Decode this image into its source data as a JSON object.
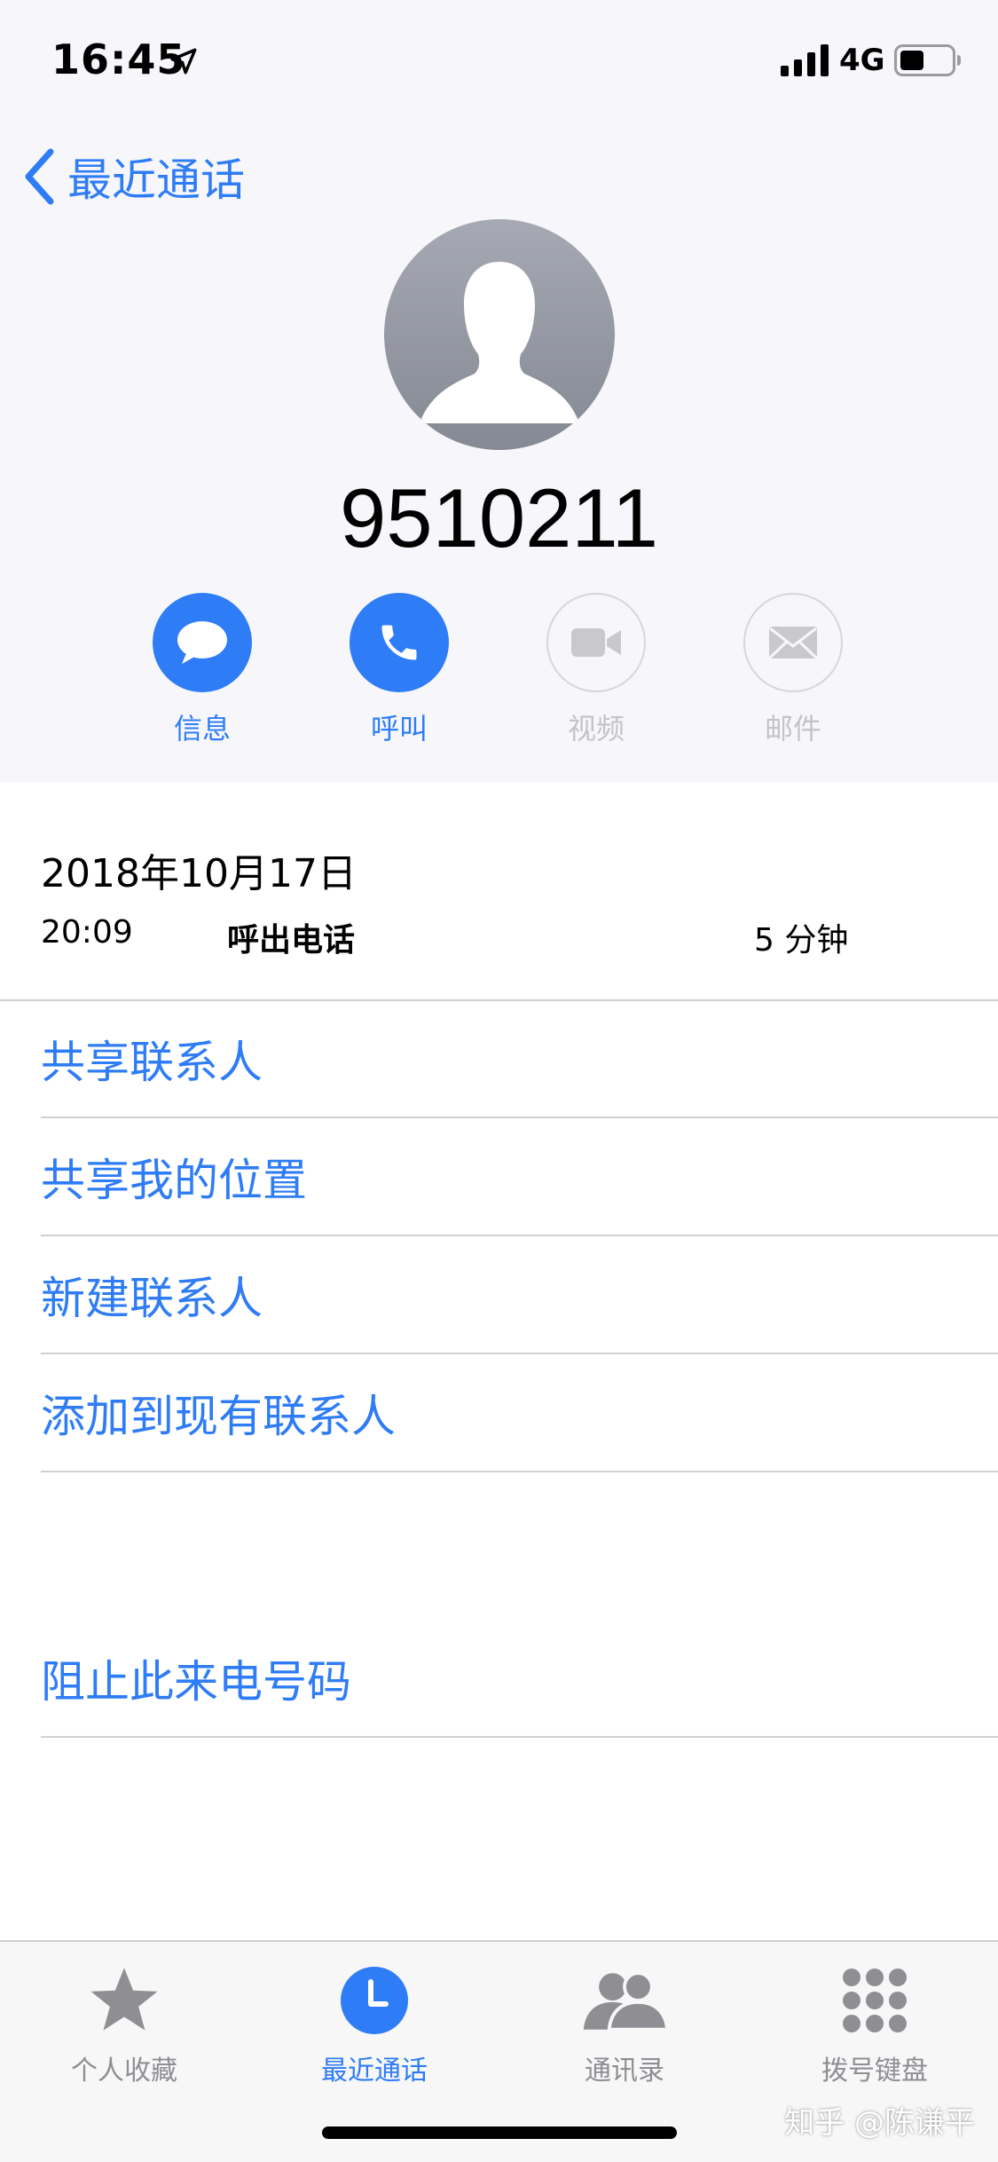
{
  "status_bar": {
    "time": "16:45",
    "network": "4G",
    "icons": [
      "location-arrow-icon",
      "signal-bars-icon",
      "battery-icon"
    ]
  },
  "nav": {
    "back_label": "最近通话",
    "back_icon": "chevron-left-icon"
  },
  "contact": {
    "number": "9510211",
    "avatar_icon": "person-silhouette-icon"
  },
  "actions": [
    {
      "label": "信息",
      "icon": "message-bubble-icon",
      "enabled": true
    },
    {
      "label": "呼叫",
      "icon": "phone-icon",
      "enabled": true
    },
    {
      "label": "视频",
      "icon": "video-camera-icon",
      "enabled": false
    },
    {
      "label": "邮件",
      "icon": "envelope-icon",
      "enabled": false
    }
  ],
  "call_log": {
    "date": "2018年10月17日",
    "entries": [
      {
        "time": "20:09",
        "type": "呼出电话",
        "duration": "5 分钟"
      }
    ]
  },
  "options": [
    "共享联系人",
    "共享我的位置",
    "新建联系人",
    "添加到现有联系人"
  ],
  "block_option": "阻止此来电号码",
  "tabbar": {
    "items": [
      {
        "label": "个人收藏",
        "icon": "star-icon",
        "active": false
      },
      {
        "label": "最近通话",
        "icon": "clock-icon",
        "active": true
      },
      {
        "label": "通讯录",
        "icon": "contacts-icon",
        "active": false
      },
      {
        "label": "拨号键盘",
        "icon": "keypad-icon",
        "active": false
      }
    ]
  },
  "watermark": "知乎 @陈谦平",
  "colors": {
    "accent": "#2e7cf6",
    "header_bg": "#f7f7fb",
    "separator": "#d0d0d5",
    "inactive": "#8e8e93"
  }
}
